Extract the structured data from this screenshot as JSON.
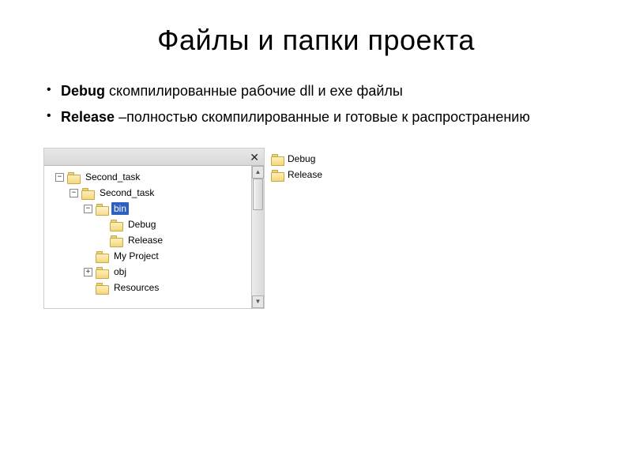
{
  "title": "Файлы и папки проекта",
  "bullets": [
    {
      "bold": "Debug",
      "rest": " скомпилированные рабочие dll и exe файлы"
    },
    {
      "bold": "Release",
      "rest": " –полностью скомпилированные и готовые к распространению"
    }
  ],
  "tree": {
    "root": {
      "label": "Second_task",
      "children": {
        "inner": {
          "label": "Second_task",
          "children": {
            "bin": {
              "label": "bin",
              "selected": true,
              "children": {
                "debug": {
                  "label": "Debug"
                },
                "release": {
                  "label": "Release"
                }
              }
            },
            "myproject": {
              "label": "My Project"
            },
            "obj": {
              "label": "obj"
            },
            "resources": {
              "label": "Resources"
            }
          }
        }
      }
    }
  },
  "right_panel": {
    "items": [
      {
        "label": "Debug"
      },
      {
        "label": "Release"
      }
    ]
  },
  "glyphs": {
    "close": "✕",
    "minus": "−",
    "plus": "+",
    "up": "▲",
    "down": "▼"
  }
}
